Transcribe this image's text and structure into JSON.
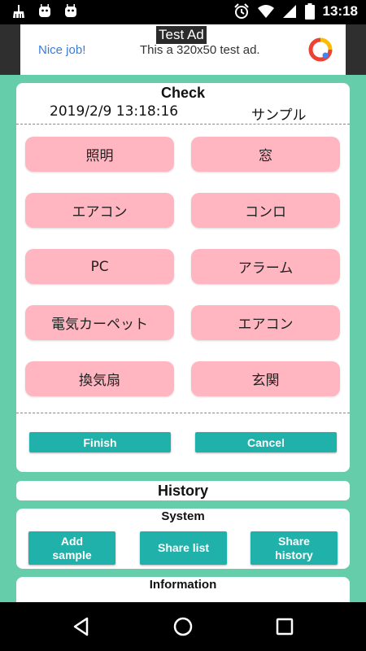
{
  "status_bar": {
    "time": "13:18",
    "left_icons": [
      "broom-icon",
      "android-icon",
      "android-icon"
    ],
    "right_icons": [
      "alarm-icon",
      "wifi-icon",
      "signal-icon",
      "battery-icon"
    ]
  },
  "ad": {
    "label": "Test Ad",
    "headline": "Nice job!",
    "text": "This a 320x50 test ad."
  },
  "check": {
    "title": "Check",
    "datetime": "2019/2/9 13:18:16",
    "name": "サンプル",
    "items": [
      "照明",
      "窓",
      "エアコン",
      "コンロ",
      "PC",
      "アラーム",
      "電気カーペット",
      "エアコン",
      "換気扇",
      "玄関"
    ],
    "finish_label": "Finish",
    "cancel_label": "Cancel"
  },
  "history": {
    "title": "History"
  },
  "system": {
    "title": "System",
    "add_sample_label": "Add\nsample",
    "share_list_label": "Share list",
    "share_history_label": "Share\nhistory"
  },
  "information": {
    "title": "Information"
  },
  "colors": {
    "background": "#66cdaa",
    "item_button": "#ffb6c1",
    "action_button": "#20b2aa"
  }
}
